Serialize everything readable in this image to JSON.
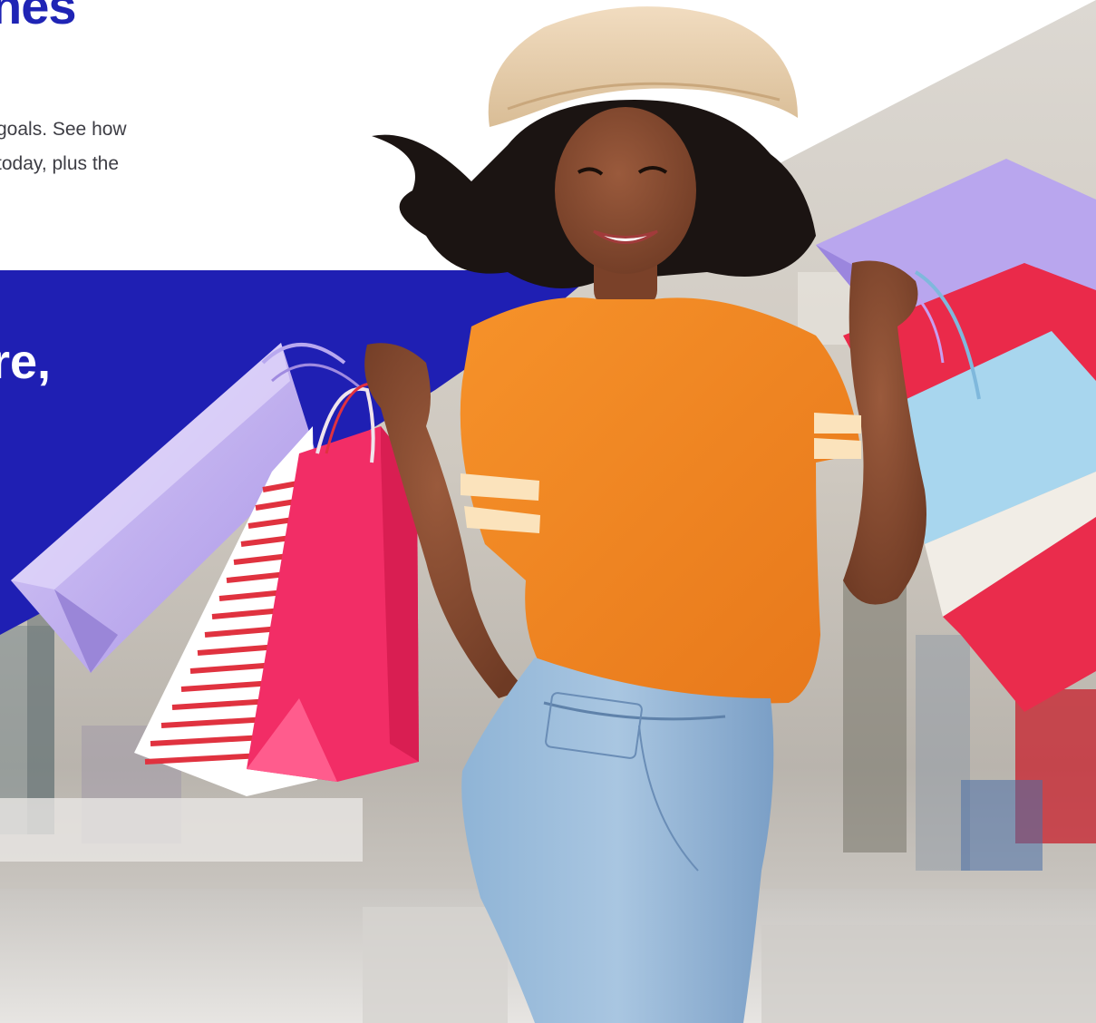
{
  "hero": {
    "headline": "nes",
    "body_line_1": "goals. See how",
    "body_line_2": "today, plus the"
  },
  "promo": {
    "headline": "re,"
  },
  "colors": {
    "brand_blue": "#1f1fb3",
    "headline_blue": "#1f24b5",
    "body_text": "#3d3d44",
    "shirt_orange": "#f2851f",
    "bag_lilac": "#b9a6ee",
    "bag_red": "#ea2a4a",
    "bag_pink": "#f22d66",
    "bag_blue": "#a8d6ee",
    "jeans_blue": "#7ea6cc"
  },
  "image": {
    "icon": "shopping-woman-photo"
  }
}
